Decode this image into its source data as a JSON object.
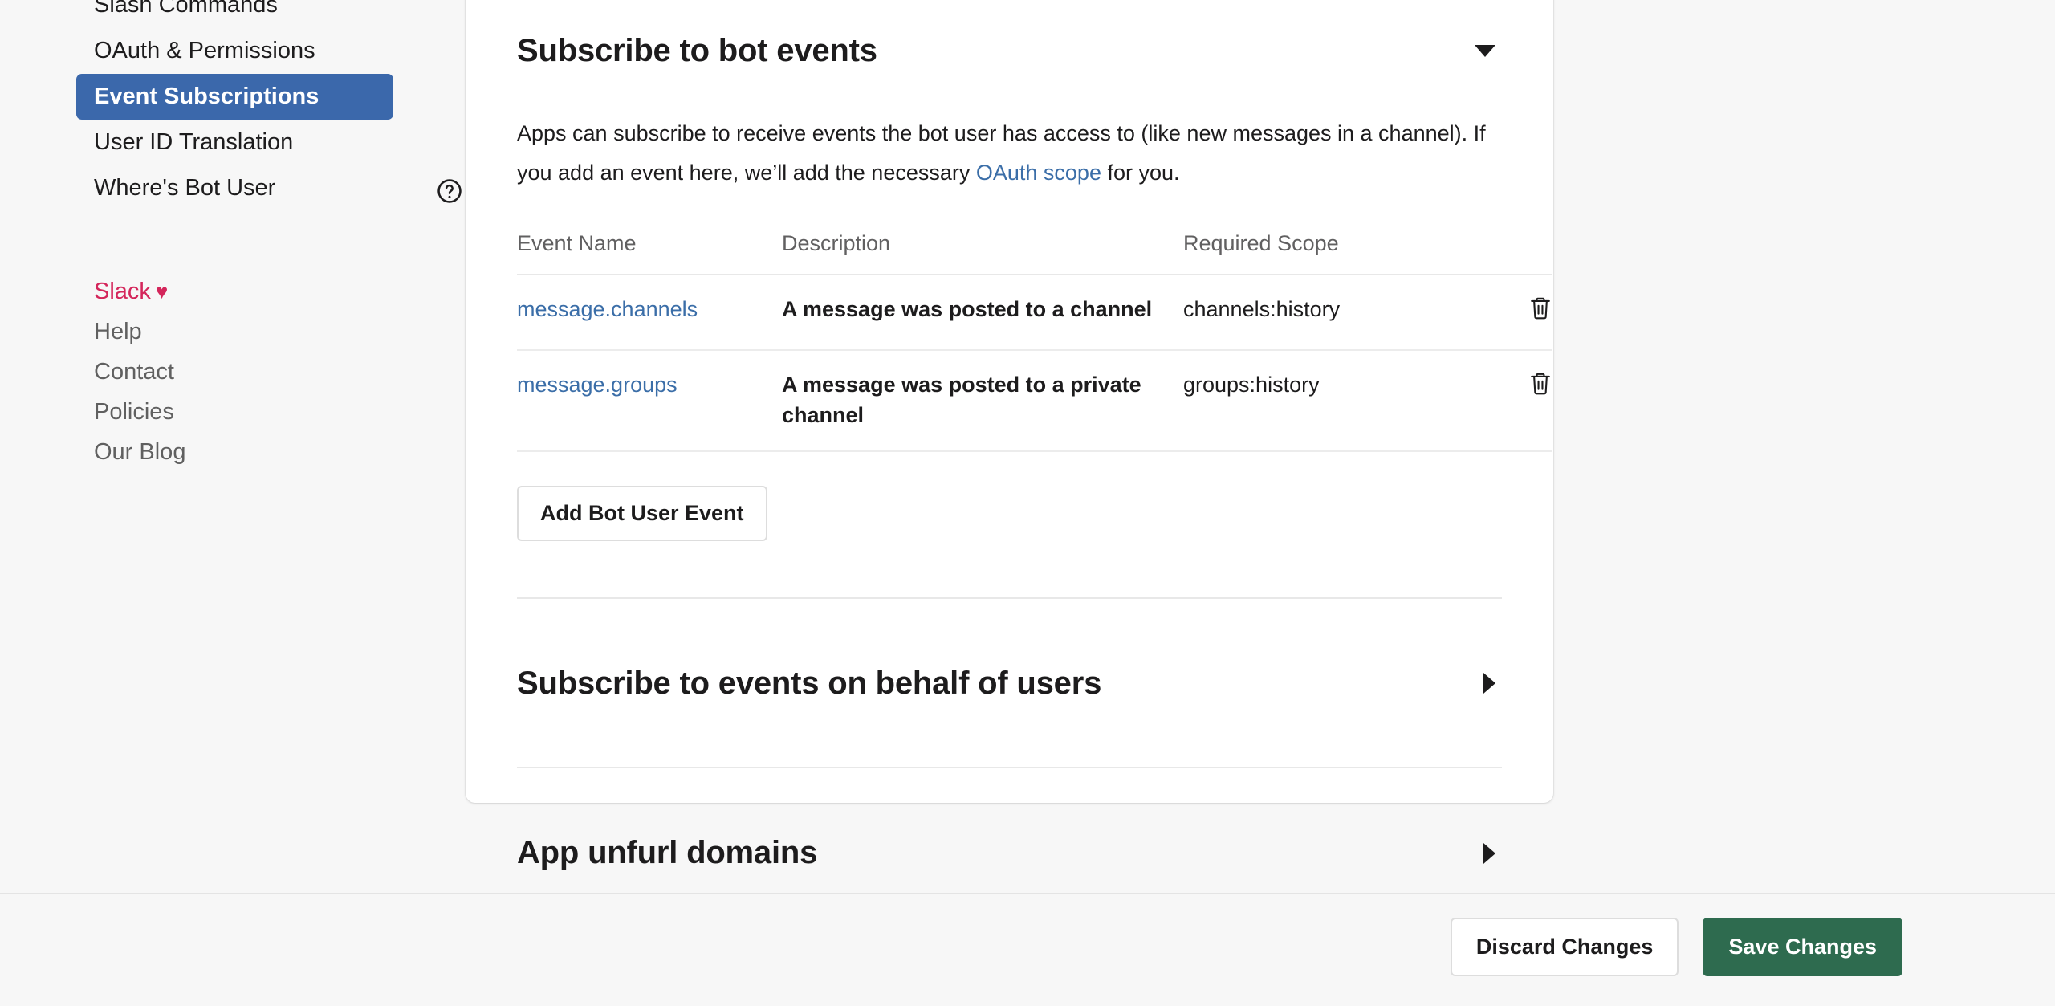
{
  "sidebar": {
    "nav_items": [
      {
        "label": "Slash Commands",
        "selected": false,
        "has_help_icon": false
      },
      {
        "label": "OAuth & Permissions",
        "selected": false,
        "has_help_icon": false
      },
      {
        "label": "Event Subscriptions",
        "selected": true,
        "has_help_icon": false
      },
      {
        "label": "User ID Translation",
        "selected": false,
        "has_help_icon": false
      },
      {
        "label": "Where's Bot User",
        "selected": false,
        "has_help_icon": true
      }
    ],
    "footer_links": [
      {
        "label": "Slack",
        "brand": true
      },
      {
        "label": "Help",
        "brand": false
      },
      {
        "label": "Contact",
        "brand": false
      },
      {
        "label": "Policies",
        "brand": false
      },
      {
        "label": "Our Blog",
        "brand": false
      }
    ],
    "heart_glyph": "♥",
    "help_icon_name": "help-circle-icon"
  },
  "main": {
    "bot_events_section": {
      "title": "Subscribe to bot events",
      "expanded": true,
      "toggle_icon": "chevron-down-icon",
      "description_before_link": "Apps can subscribe to receive events the bot user has access to (like new messages in a channel). If you add an event here, we’ll add the necessary ",
      "description_link": "OAuth scope",
      "description_after_link": " for you.",
      "table": {
        "columns": [
          "Event Name",
          "Description",
          "Required Scope",
          ""
        ],
        "rows": [
          {
            "event_name": "message.channels",
            "description": "A message was posted to a channel",
            "required_scope": "channels:history",
            "delete_icon": "trash-icon"
          },
          {
            "event_name": "message.groups",
            "description": "A message was posted to a private channel",
            "required_scope": "groups:history",
            "delete_icon": "trash-icon"
          }
        ]
      },
      "add_button_label": "Add Bot User Event"
    },
    "collapsed_sections": [
      {
        "title": "Subscribe to events on behalf of users",
        "expanded": false,
        "toggle_icon": "chevron-right-icon"
      },
      {
        "title": "App unfurl domains",
        "expanded": false,
        "toggle_icon": "chevron-right-icon"
      }
    ]
  },
  "action_bar": {
    "discard_label": "Discard Changes",
    "save_label": "Save Changes"
  },
  "colors": {
    "selected_nav_bg": "#3b68ab",
    "link_blue": "#3b6ea8",
    "brand_pink": "#d4265b",
    "save_green": "#2e6b4f",
    "page_bg": "#f7f7f7",
    "card_bg": "#ffffff",
    "text_primary": "#1d1c1d",
    "text_muted": "#616061"
  }
}
